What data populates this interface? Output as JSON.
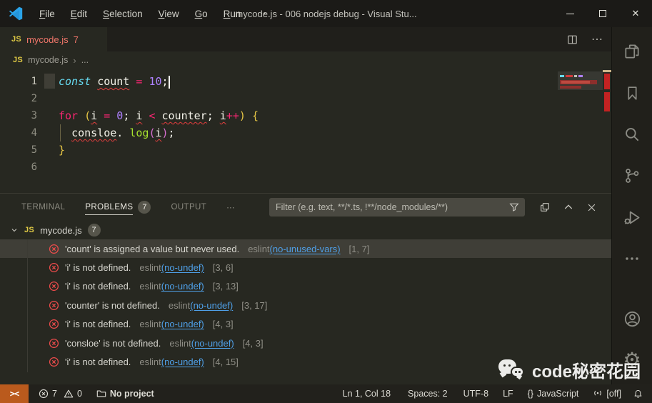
{
  "window": {
    "title": "mycode.js - 006 nodejs debug - Visual Stu...",
    "close_glyph": "✕"
  },
  "menubar": {
    "items": [
      "File",
      "Edit",
      "Selection",
      "View",
      "Go",
      "Run",
      "⋯"
    ]
  },
  "tab": {
    "lang_badge": "JS",
    "name": "mycode.js",
    "error_count": "7"
  },
  "editor_actions": {
    "more_glyph": "⋯"
  },
  "breadcrumb": {
    "lang_badge": "JS",
    "file": "mycode.js",
    "separator": "›",
    "more": "..."
  },
  "editor": {
    "lines": [
      {
        "num": "1",
        "active": true,
        "cursor": true,
        "tokens": [
          {
            "t": "const",
            "c": "kw"
          },
          {
            "t": " ",
            "c": "pl"
          },
          {
            "t": "count",
            "c": "pl",
            "sq": true
          },
          {
            "t": " ",
            "c": "pl"
          },
          {
            "t": "=",
            "c": "op"
          },
          {
            "t": " ",
            "c": "pl"
          },
          {
            "t": "10",
            "c": "num"
          },
          {
            "t": ";",
            "c": "pl"
          }
        ]
      },
      {
        "num": "2",
        "tokens": []
      },
      {
        "num": "3",
        "tokens": [
          {
            "t": "for",
            "c": "op"
          },
          {
            "t": " ",
            "c": "pl"
          },
          {
            "t": "(",
            "c": "b1"
          },
          {
            "t": "i",
            "c": "pl",
            "sq": true
          },
          {
            "t": " ",
            "c": "pl"
          },
          {
            "t": "=",
            "c": "op"
          },
          {
            "t": " ",
            "c": "pl"
          },
          {
            "t": "0",
            "c": "num"
          },
          {
            "t": "; ",
            "c": "pl"
          },
          {
            "t": "i",
            "c": "pl",
            "sq": true
          },
          {
            "t": " ",
            "c": "pl"
          },
          {
            "t": "<",
            "c": "op"
          },
          {
            "t": " ",
            "c": "pl"
          },
          {
            "t": "counter",
            "c": "pl",
            "sq": true
          },
          {
            "t": "; ",
            "c": "pl"
          },
          {
            "t": "i",
            "c": "pl",
            "sq": true
          },
          {
            "t": "++",
            "c": "op"
          },
          {
            "t": ")",
            "c": "b1"
          },
          {
            "t": " ",
            "c": "pl"
          },
          {
            "t": "{",
            "c": "b1"
          }
        ]
      },
      {
        "num": "4",
        "tokens": [
          {
            "t": "  ",
            "c": "pl"
          },
          {
            "t": "consloe",
            "c": "pl",
            "sq": true
          },
          {
            "t": ".",
            "c": "pl"
          },
          {
            "t": " ",
            "c": "pl"
          },
          {
            "t": "log",
            "c": "fn"
          },
          {
            "t": "(",
            "c": "b2"
          },
          {
            "t": "i",
            "c": "pl",
            "sq": true
          },
          {
            "t": ")",
            "c": "b2"
          },
          {
            "t": ";",
            "c": "pl"
          }
        ]
      },
      {
        "num": "5",
        "tokens": [
          {
            "t": "}",
            "c": "b1"
          }
        ]
      },
      {
        "num": "6",
        "tokens": []
      }
    ]
  },
  "panel": {
    "tabs": [
      {
        "label": "TERMINAL"
      },
      {
        "label": "PROBLEMS",
        "badge": "7",
        "active": true
      },
      {
        "label": "OUTPUT"
      },
      {
        "label": "⋯"
      }
    ],
    "filter_placeholder": "Filter (e.g. text, **/*.ts, !**/node_modules/**)",
    "group": {
      "lang_badge": "JS",
      "file": "mycode.js",
      "badge": "7"
    },
    "problems": [
      {
        "msg": "'count' is assigned a value but never used.",
        "src": "eslint",
        "rule": "(no-unused-vars)",
        "pos": "[1, 7]",
        "selected": true
      },
      {
        "msg": "'i' is not defined.",
        "src": "eslint",
        "rule": "(no-undef)",
        "pos": "[3, 6]"
      },
      {
        "msg": "'i' is not defined.",
        "src": "eslint",
        "rule": "(no-undef)",
        "pos": "[3, 13]"
      },
      {
        "msg": "'counter' is not defined.",
        "src": "eslint",
        "rule": "(no-undef)",
        "pos": "[3, 17]"
      },
      {
        "msg": "'i' is not defined.",
        "src": "eslint",
        "rule": "(no-undef)",
        "pos": "[4, 3]"
      },
      {
        "msg": "'consloe' is not defined.",
        "src": "eslint",
        "rule": "(no-undef)",
        "pos": "[4, 3]"
      },
      {
        "msg": "'i' is not defined.",
        "src": "eslint",
        "rule": "(no-undef)",
        "pos": "[4, 15]"
      }
    ]
  },
  "statusbar": {
    "remote_glyph": "><",
    "errors": "7",
    "warnings": "0",
    "project": "No project",
    "cursor_position": "Ln 1, Col 18",
    "indentation": "Spaces: 2",
    "encoding": "UTF-8",
    "eol": "LF",
    "braces_glyph": "{}",
    "language": "JavaScript",
    "screencast": "[off]"
  },
  "watermark": {
    "text": "code秘密花园"
  },
  "colors": {
    "error_red": "#f14c4c",
    "link_blue": "#4fa0e8",
    "tab_error_text": "#f0766a",
    "remote_orange": "#ba5a1d",
    "js_yellow": "#e0ca45"
  }
}
